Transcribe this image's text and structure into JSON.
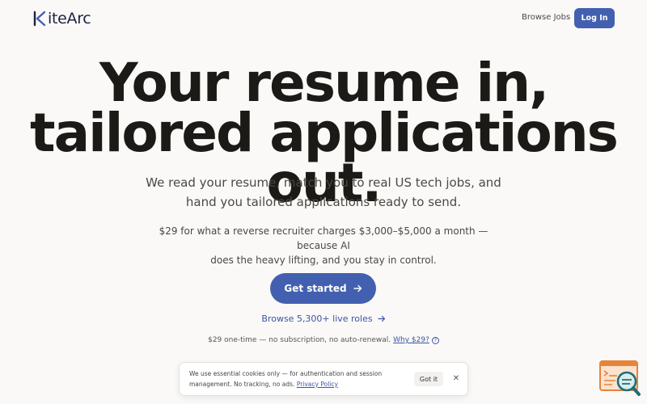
{
  "header": {
    "logo_text": "iteArc",
    "nav_browse": "Browse Jobs",
    "login_label": "Log In"
  },
  "hero": {
    "headline_line1": "Your resume in,",
    "headline_line2": "tailored applications out.",
    "subtitle_line1": "We read your resume, match you to real US tech jobs, and",
    "subtitle_line2": "hand you tailored applications ready to send.",
    "pricing_line1": "$29 for what a reverse recruiter charges $3,000–$5,000 a month — because AI",
    "pricing_line2": "does the heavy lifting, and you stay in control.",
    "cta_label": "Get started",
    "browse_label": "Browse 5,300+ live roles",
    "note_text": "$29 one-time — no subscription, no auto-renewal.",
    "why_link": "Why $29?",
    "help_glyph": "?"
  },
  "cookie": {
    "line1": "We use essential cookies only — for authentication and session",
    "line2_prefix": "management. No tracking, no ads.",
    "policy_link": "Privacy Policy",
    "got_it_label": "Got it",
    "close_glyph": "✕"
  },
  "icons": {
    "logo": "kite-k-logo-icon",
    "cta_arrow": "arrow-right-icon",
    "browse_arrow": "arrow-right-icon",
    "help": "question-circle-icon",
    "close": "close-icon",
    "widget": "search-feedback-widget-icon"
  },
  "colors": {
    "accent": "#4360b0",
    "background": "#faf9f7",
    "text": "#1c1a17",
    "link": "#3b55a6",
    "widget_orange": "#e8833a",
    "widget_teal": "#1f6f78"
  }
}
